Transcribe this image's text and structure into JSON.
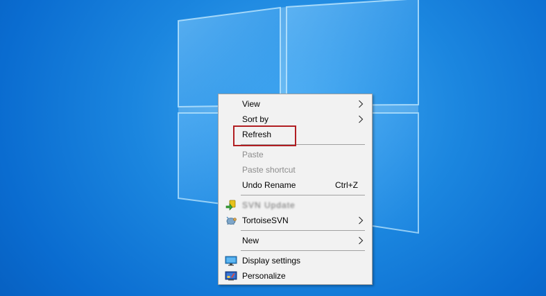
{
  "desktop": {
    "background_color": "#0a6cd0",
    "wallpaper_icon": "windows-logo"
  },
  "context_menu": {
    "items": [
      {
        "label": "View",
        "has_submenu": true,
        "enabled": true
      },
      {
        "label": "Sort by",
        "has_submenu": true,
        "enabled": true
      },
      {
        "label": "Refresh",
        "has_submenu": false,
        "enabled": true,
        "highlighted": true
      },
      {
        "label": "Paste",
        "has_submenu": false,
        "enabled": false
      },
      {
        "label": "Paste shortcut",
        "has_submenu": false,
        "enabled": false
      },
      {
        "label": "Undo Rename",
        "shortcut": "Ctrl+Z",
        "has_submenu": false,
        "enabled": true
      },
      {
        "label": "SVN Update",
        "icon": "svn-update-icon",
        "obscured": true,
        "enabled": true
      },
      {
        "label": "TortoiseSVN",
        "icon": "tortoisesvn-icon",
        "has_submenu": true,
        "enabled": true
      },
      {
        "label": "New",
        "has_submenu": true,
        "enabled": true
      },
      {
        "label": "Display settings",
        "icon": "display-settings-icon",
        "enabled": true
      },
      {
        "label": "Personalize",
        "icon": "personalize-icon",
        "enabled": true
      }
    ]
  },
  "annotation": {
    "highlight_color": "#b11e22",
    "target": "Refresh"
  }
}
